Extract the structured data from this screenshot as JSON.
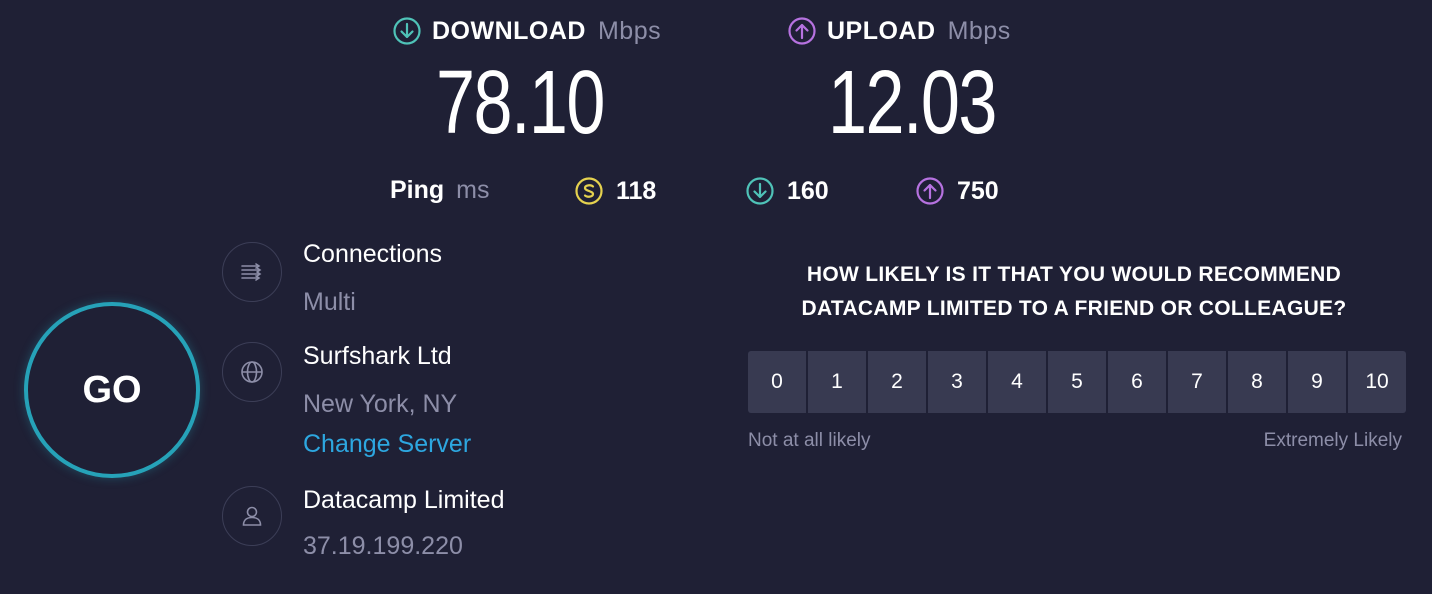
{
  "download": {
    "label": "DOWNLOAD",
    "unit": "Mbps",
    "value": "78.10",
    "icon": "download-arrow-icon",
    "color": "#4fc3b8"
  },
  "upload": {
    "label": "UPLOAD",
    "unit": "Mbps",
    "value": "12.03",
    "icon": "upload-arrow-icon",
    "color": "#b672e0"
  },
  "ping": {
    "label": "Ping",
    "unit": "ms",
    "idle": {
      "value": "118",
      "icon": "idle-ping-icon",
      "color": "#e5d24f"
    },
    "download": {
      "value": "160",
      "icon": "download-ping-icon",
      "color": "#4fc3b8"
    },
    "upload": {
      "value": "750",
      "icon": "upload-ping-icon",
      "color": "#b672e0"
    }
  },
  "go_button": {
    "label": "GO",
    "color": "#26a2b8"
  },
  "connections": {
    "title": "Connections",
    "value": "Multi",
    "icon": "connections-icon"
  },
  "server": {
    "name": "Surfshark Ltd",
    "location": "New York, NY",
    "change_label": "Change Server",
    "icon": "globe-icon"
  },
  "provider": {
    "name": "Datacamp Limited",
    "ip": "37.19.199.220",
    "icon": "user-icon"
  },
  "survey": {
    "question_line1": "HOW LIKELY IS IT THAT YOU WOULD RECOMMEND",
    "question_line2": "DATACAMP LIMITED TO A FRIEND OR COLLEAGUE?",
    "options": [
      "0",
      "1",
      "2",
      "3",
      "4",
      "5",
      "6",
      "7",
      "8",
      "9",
      "10"
    ],
    "low_label": "Not at all likely",
    "high_label": "Extremely Likely"
  }
}
